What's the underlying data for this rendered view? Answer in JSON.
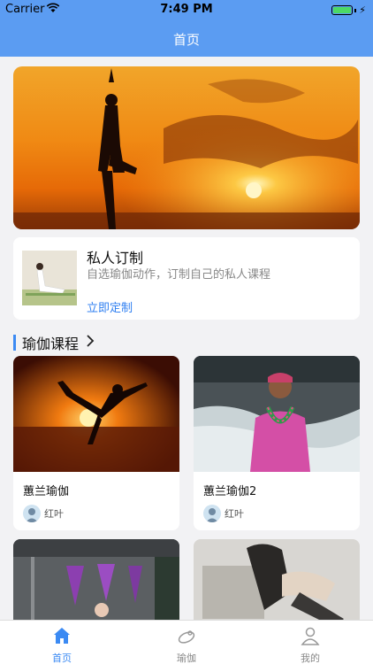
{
  "status_bar": {
    "carrier": "Carrier",
    "time": "7:49 PM"
  },
  "nav": {
    "title": "首页"
  },
  "custom": {
    "title": "私人订制",
    "description": "自选瑜伽动作，订制自己的私人课程",
    "link": "立即定制"
  },
  "section": {
    "title": "瑜伽课程"
  },
  "courses": [
    {
      "name": "蕙兰瑜伽",
      "author": "红叶"
    },
    {
      "name": "蕙兰瑜伽2",
      "author": "红叶"
    }
  ],
  "tabs": [
    {
      "label": "首页"
    },
    {
      "label": "瑜伽"
    },
    {
      "label": "我的"
    }
  ],
  "colors": {
    "accent": "#5b9cf2",
    "link": "#2f7ff1",
    "tab_inactive": "#888888"
  }
}
